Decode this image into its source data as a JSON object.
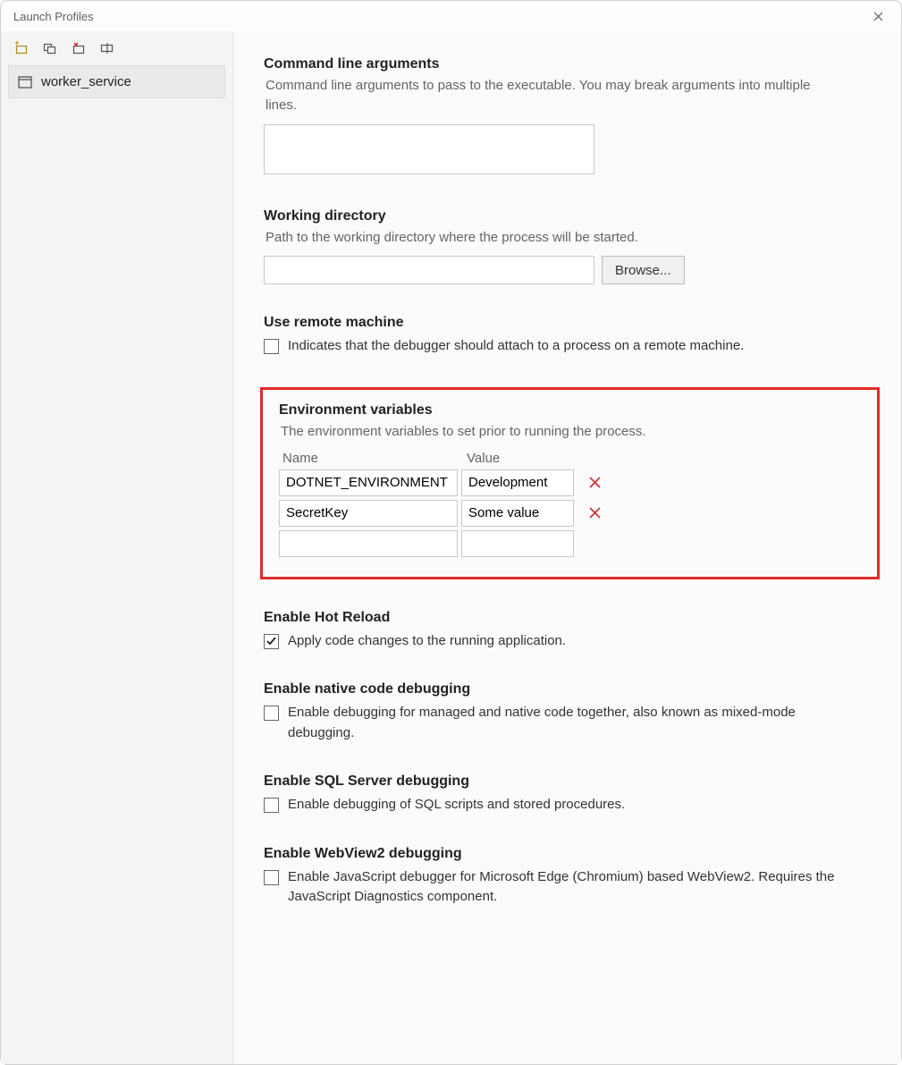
{
  "window": {
    "title": "Launch Profiles"
  },
  "sidebar": {
    "profiles": [
      {
        "name": "worker_service"
      }
    ]
  },
  "sections": {
    "cmdline": {
      "heading": "Command line arguments",
      "desc": "Command line arguments to pass to the executable. You may break arguments into multiple lines.",
      "value": ""
    },
    "workdir": {
      "heading": "Working directory",
      "desc": "Path to the working directory where the process will be started.",
      "value": "",
      "browse": "Browse..."
    },
    "remote": {
      "heading": "Use remote machine",
      "checkbox": "Indicates that the debugger should attach to a process on a remote machine.",
      "checked": false
    },
    "env": {
      "heading": "Environment variables",
      "desc": "The environment variables to set prior to running the process.",
      "col_name": "Name",
      "col_value": "Value",
      "rows": [
        {
          "name": "DOTNET_ENVIRONMENT",
          "value": "Development"
        },
        {
          "name": "SecretKey",
          "value": "Some value"
        },
        {
          "name": "",
          "value": ""
        }
      ]
    },
    "hotreload": {
      "heading": "Enable Hot Reload",
      "checkbox": "Apply code changes to the running application.",
      "checked": true
    },
    "native": {
      "heading": "Enable native code debugging",
      "checkbox": "Enable debugging for managed and native code together, also known as mixed-mode debugging.",
      "checked": false
    },
    "sql": {
      "heading": "Enable SQL Server debugging",
      "checkbox": "Enable debugging of SQL scripts and stored procedures.",
      "checked": false
    },
    "webview": {
      "heading": "Enable WebView2 debugging",
      "checkbox": "Enable JavaScript debugger for Microsoft Edge (Chromium) based WebView2. Requires the JavaScript Diagnostics component.",
      "checked": false
    }
  }
}
